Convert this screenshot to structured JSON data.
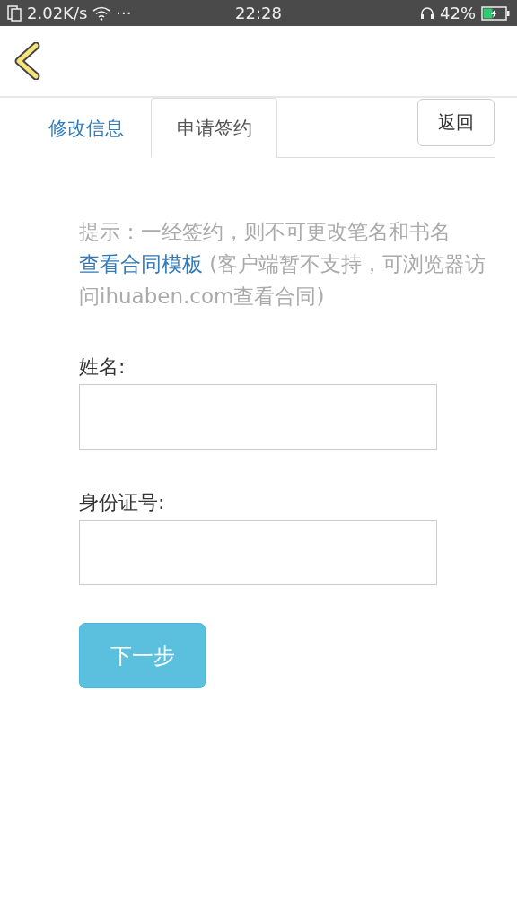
{
  "status_bar": {
    "speed": "2.02K/s",
    "dots": "···",
    "time": "22:28",
    "battery": "42%"
  },
  "tabs": [
    {
      "label": "修改信息",
      "selected": false
    },
    {
      "label": "申请签约",
      "selected": true
    }
  ],
  "return_button": "返回",
  "hint": "提示：一经签约，则不可更改笔名和书名",
  "contract_link": "查看合同模板",
  "contract_note": " (客户端暂不支持，可浏览器访问ihuaben.com查看合同)",
  "fields": [
    {
      "label": "姓名:"
    },
    {
      "label": "身份证号:"
    }
  ],
  "next_button": "下一步"
}
